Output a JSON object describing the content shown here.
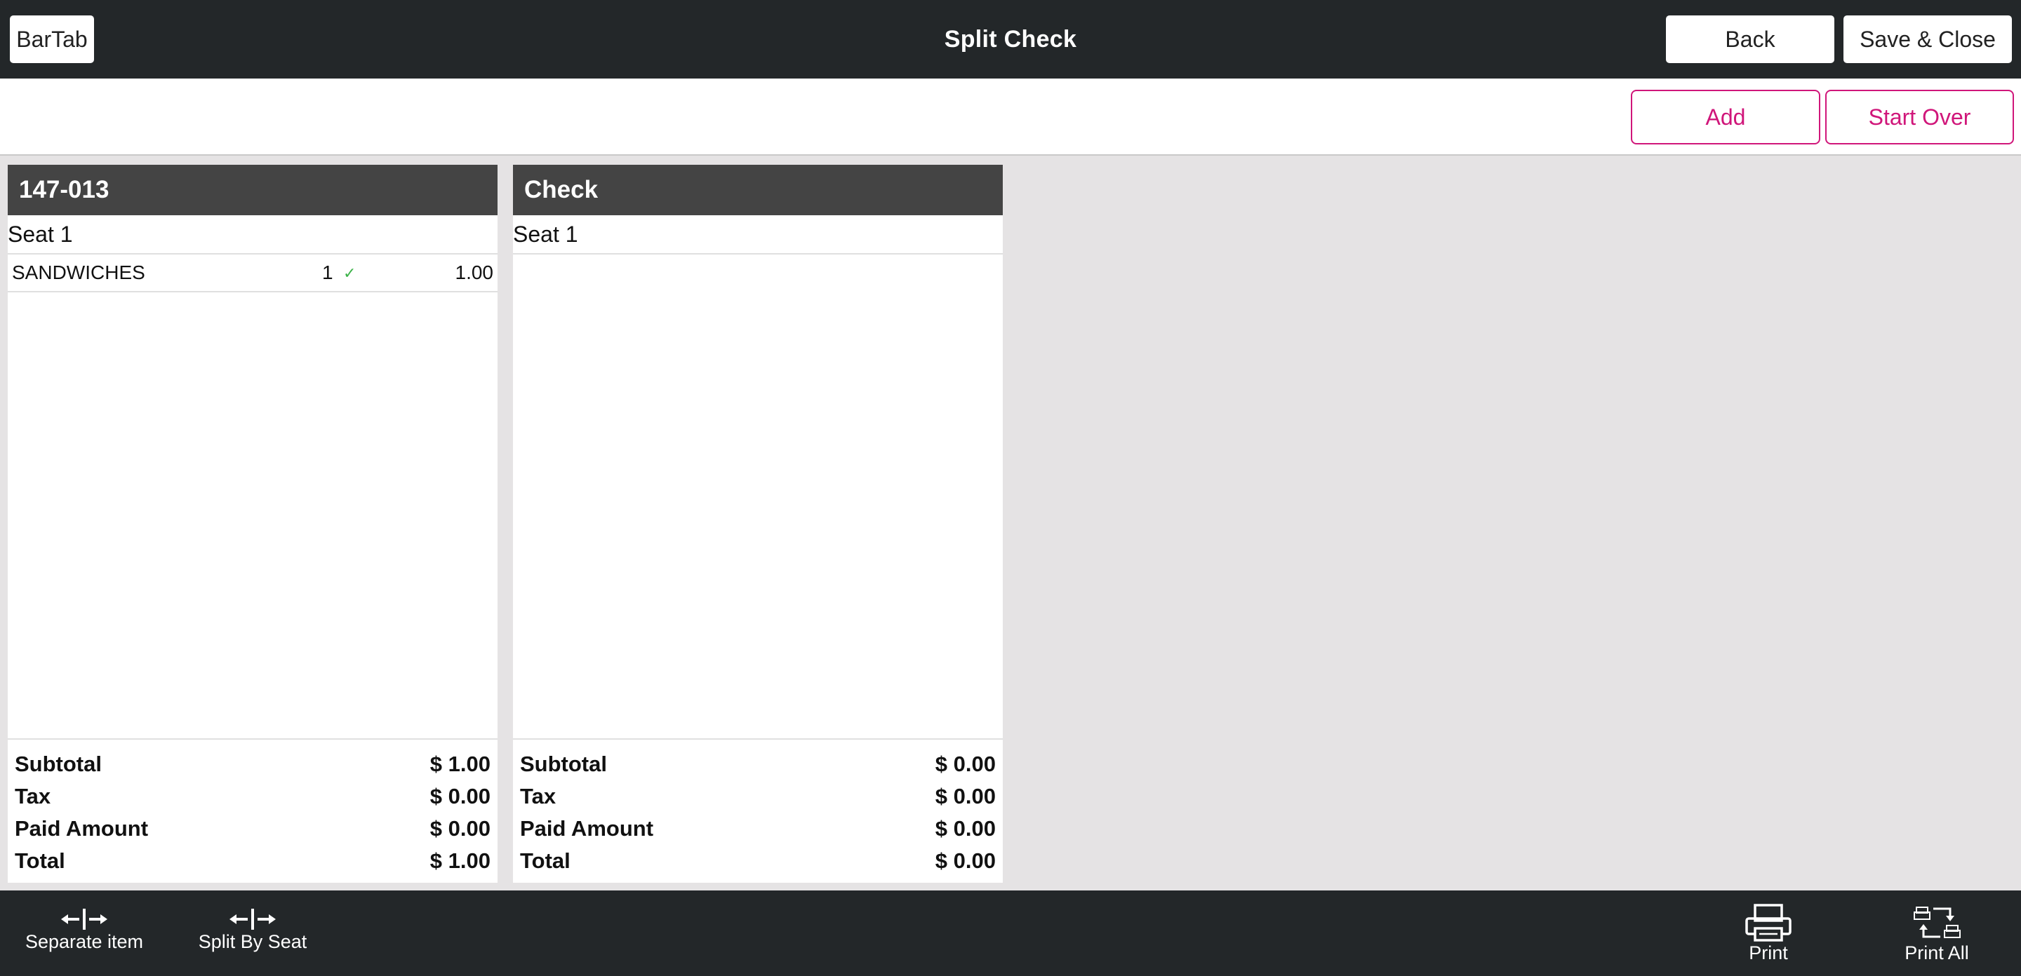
{
  "header": {
    "app_button": "BarTab",
    "title": "Split Check",
    "back_label": "Back",
    "save_close_label": "Save & Close"
  },
  "actions": {
    "add_label": "Add",
    "start_over_label": "Start Over"
  },
  "checks": [
    {
      "title": "147-013",
      "seat": "Seat 1",
      "items": [
        {
          "name": "SANDWICHES",
          "qty": "1",
          "price": "1.00"
        }
      ],
      "totals": {
        "subtotal_label": "Subtotal",
        "subtotal": "$ 1.00",
        "tax_label": "Tax",
        "tax": "$ 0.00",
        "paid_label": "Paid Amount",
        "paid": "$ 0.00",
        "total_label": "Total",
        "total": "$ 1.00"
      }
    },
    {
      "title": "Check",
      "seat": "Seat 1",
      "items": [],
      "totals": {
        "subtotal_label": "Subtotal",
        "subtotal": "$ 0.00",
        "tax_label": "Tax",
        "tax": "$ 0.00",
        "paid_label": "Paid Amount",
        "paid": "$ 0.00",
        "total_label": "Total",
        "total": "$ 0.00"
      }
    }
  ],
  "footer": {
    "separate_item_label": "Separate item",
    "split_by_seat_label": "Split By Seat",
    "print_label": "Print",
    "print_all_label": "Print All"
  },
  "colors": {
    "accent": "#d0167a",
    "topbar": "#232729",
    "panel_header": "#444444",
    "background": "#e5e3e4"
  },
  "icons": [
    "separate-arrows-icon",
    "split-seat-arrows-icon",
    "printer-icon",
    "print-all-icon",
    "checkmark-icon"
  ]
}
